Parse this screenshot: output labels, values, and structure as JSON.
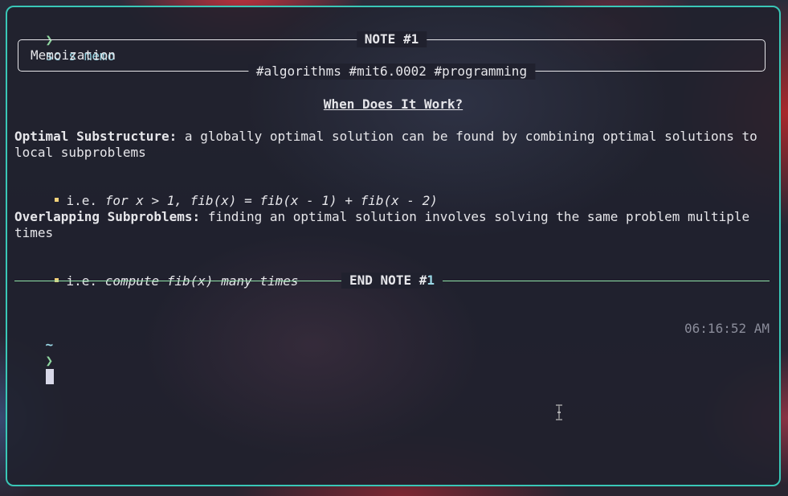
{
  "command": {
    "arrow": "❯",
    "text": "sc s memo"
  },
  "note": {
    "title": "NOTE #1",
    "content": "Memoization",
    "tags": "#algorithms #mit6.0002 #programming"
  },
  "body": {
    "heading": "When Does It Work?",
    "sections": [
      {
        "term": "Optimal Substructure:",
        "description": " a globally optimal solution can be found by combining optimal solutions to local subproblems",
        "bullet_prefix": "i.e. ",
        "bullet_text": "for x > 1, fib(x) = fib(x - 1) + fib(x - 2)"
      },
      {
        "term": "Overlapping Subproblems:",
        "description": " finding an optimal solution involves solving the same problem multiple times",
        "bullet_prefix": "i.e. ",
        "bullet_text": "compute fib(x) many times"
      }
    ]
  },
  "end_note": {
    "label": "END NOTE #",
    "number": "1"
  },
  "prompt": {
    "tilde": "~",
    "arrow": "❯"
  },
  "clock": "06:16:52 AM",
  "colors": {
    "border": "#39c7b7",
    "prompt_arrow": "#8fd6a0",
    "command": "#9ad8e6",
    "bullet": "#f3d27a",
    "end_rule": "#8fe3a8",
    "clock": "#8a8c9a"
  }
}
